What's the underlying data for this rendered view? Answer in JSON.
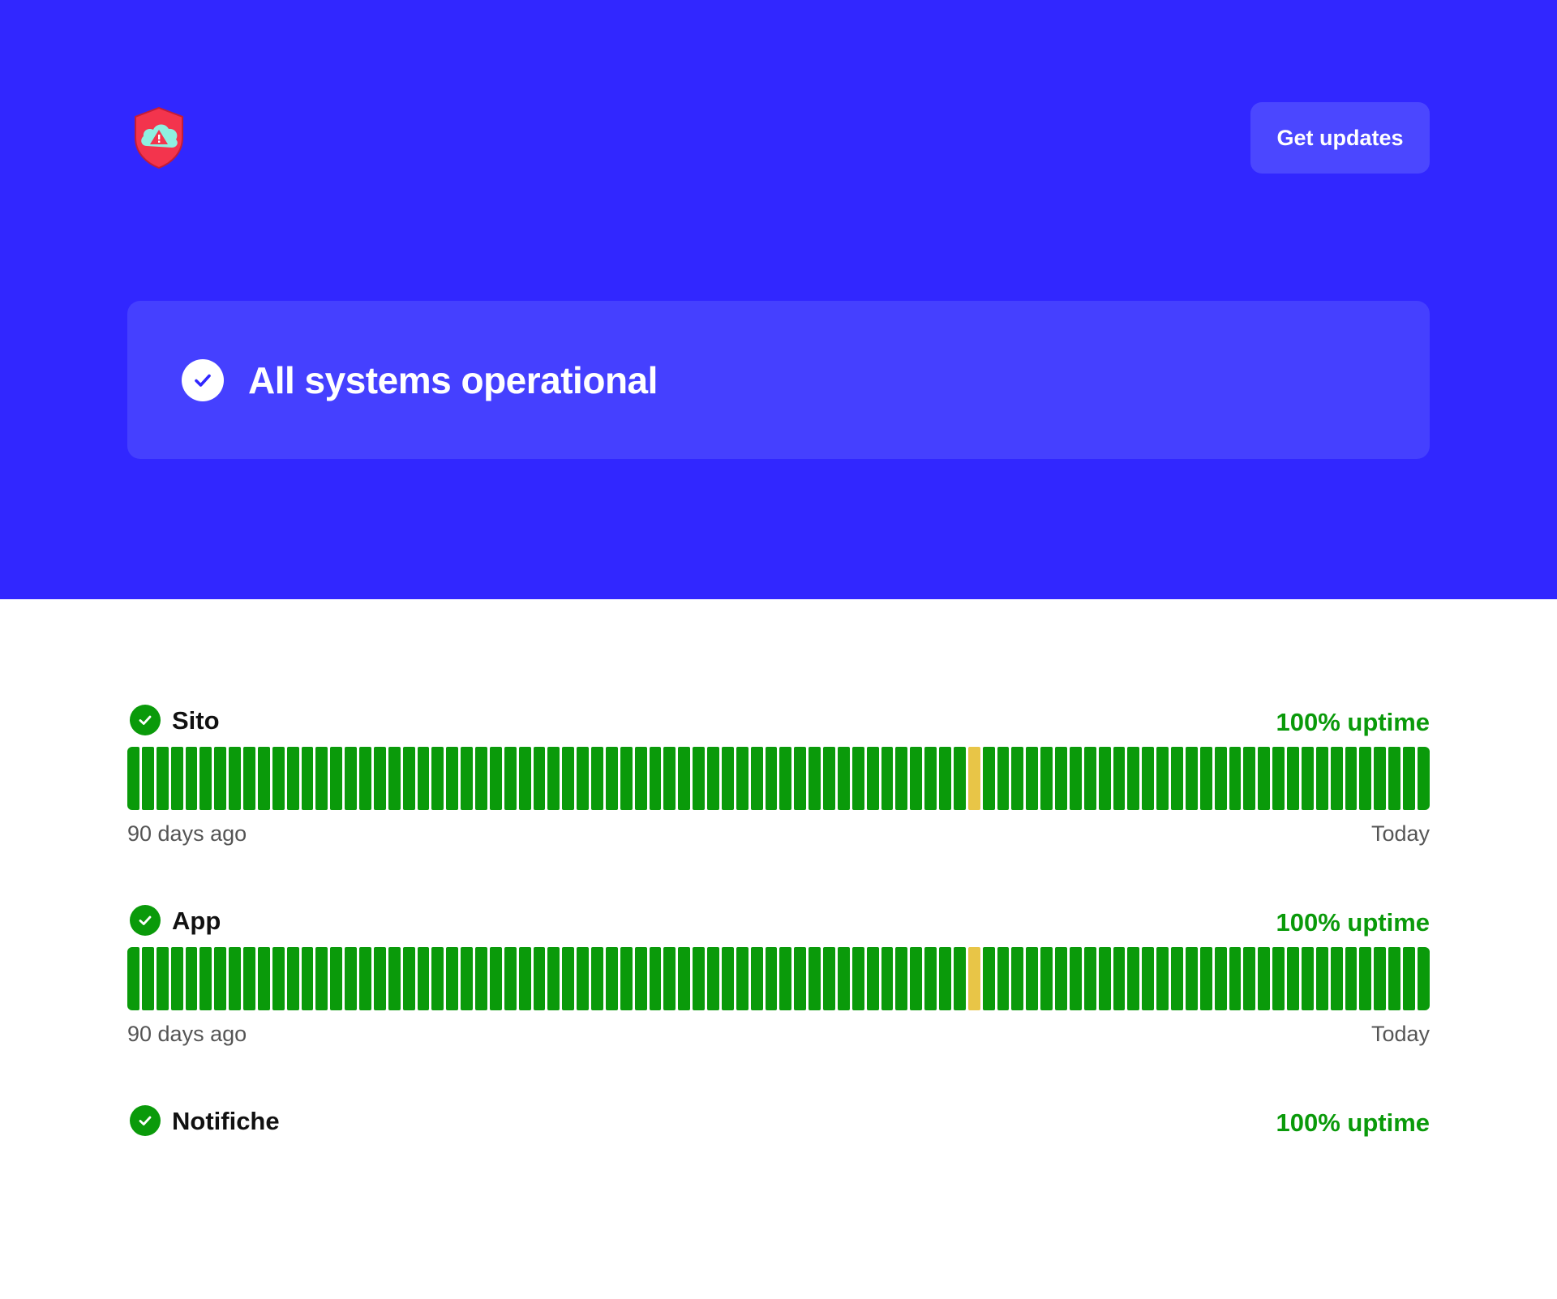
{
  "colors": {
    "hero_bg": "#3127ff",
    "banner_bg": "#4540ff",
    "button_bg": "#4b47ff",
    "up": "#0a9a0a",
    "degraded": "#e8c547",
    "uptime_text": "#0a9a0a"
  },
  "header": {
    "logo_icon": "shield-cloud-warning-icon",
    "updates_label": "Get updates"
  },
  "status": {
    "icon": "check-circle-icon",
    "title": "All systems operational"
  },
  "components": [
    {
      "name": "Sito",
      "uptime": "100% uptime",
      "range_start": "90 days ago",
      "range_end": "Today",
      "bars": [
        "up",
        "up",
        "up",
        "up",
        "up",
        "up",
        "up",
        "up",
        "up",
        "up",
        "up",
        "up",
        "up",
        "up",
        "up",
        "up",
        "up",
        "up",
        "up",
        "up",
        "up",
        "up",
        "up",
        "up",
        "up",
        "up",
        "up",
        "up",
        "up",
        "up",
        "up",
        "up",
        "up",
        "up",
        "up",
        "up",
        "up",
        "up",
        "up",
        "up",
        "up",
        "up",
        "up",
        "up",
        "up",
        "up",
        "up",
        "up",
        "up",
        "up",
        "up",
        "up",
        "up",
        "up",
        "up",
        "up",
        "up",
        "up",
        "degraded",
        "up",
        "up",
        "up",
        "up",
        "up",
        "up",
        "up",
        "up",
        "up",
        "up",
        "up",
        "up",
        "up",
        "up",
        "up",
        "up",
        "up",
        "up",
        "up",
        "up",
        "up",
        "up",
        "up",
        "up",
        "up",
        "up",
        "up",
        "up",
        "up",
        "up",
        "up"
      ]
    },
    {
      "name": "App",
      "uptime": "100% uptime",
      "range_start": "90 days ago",
      "range_end": "Today",
      "bars": [
        "up",
        "up",
        "up",
        "up",
        "up",
        "up",
        "up",
        "up",
        "up",
        "up",
        "up",
        "up",
        "up",
        "up",
        "up",
        "up",
        "up",
        "up",
        "up",
        "up",
        "up",
        "up",
        "up",
        "up",
        "up",
        "up",
        "up",
        "up",
        "up",
        "up",
        "up",
        "up",
        "up",
        "up",
        "up",
        "up",
        "up",
        "up",
        "up",
        "up",
        "up",
        "up",
        "up",
        "up",
        "up",
        "up",
        "up",
        "up",
        "up",
        "up",
        "up",
        "up",
        "up",
        "up",
        "up",
        "up",
        "up",
        "up",
        "degraded",
        "up",
        "up",
        "up",
        "up",
        "up",
        "up",
        "up",
        "up",
        "up",
        "up",
        "up",
        "up",
        "up",
        "up",
        "up",
        "up",
        "up",
        "up",
        "up",
        "up",
        "up",
        "up",
        "up",
        "up",
        "up",
        "up",
        "up",
        "up",
        "up",
        "up",
        "up"
      ]
    },
    {
      "name": "Notifiche",
      "uptime": "100% uptime",
      "range_start": "",
      "range_end": "",
      "bars": []
    }
  ]
}
